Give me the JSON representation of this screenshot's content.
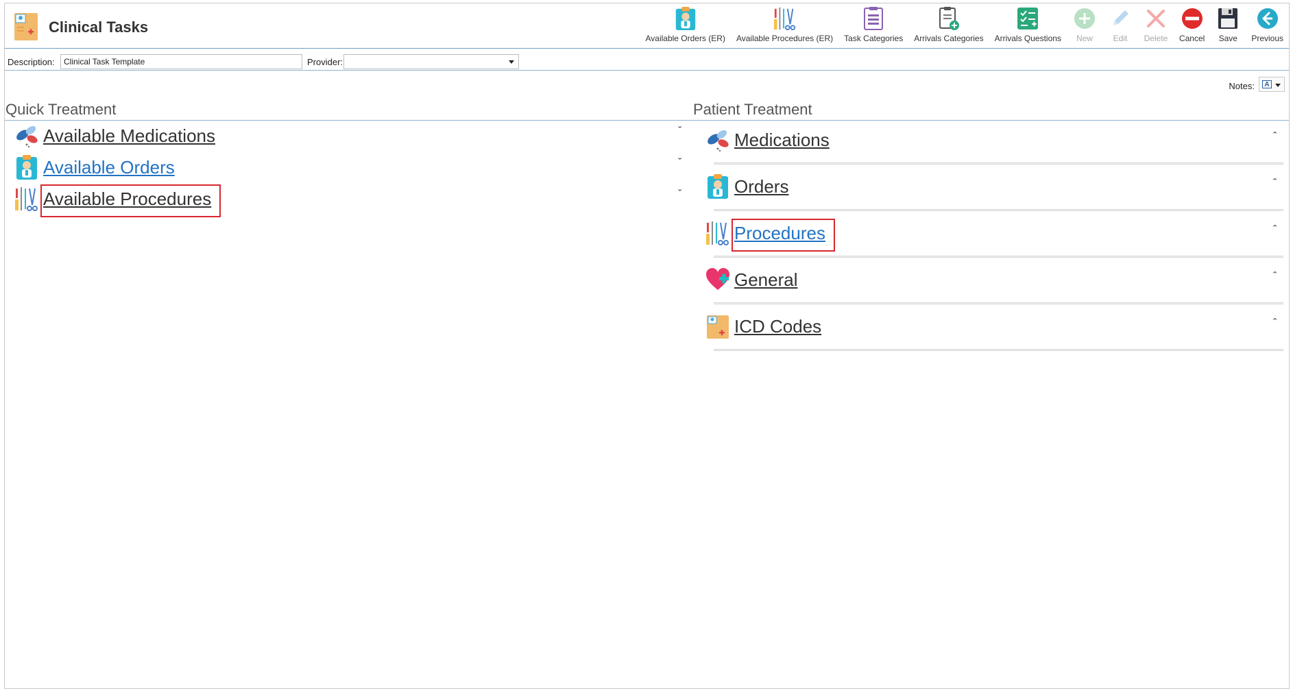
{
  "app": {
    "title": "Clinical Tasks"
  },
  "toolbar": [
    {
      "name": "available-orders-er-button",
      "label": "Available Orders (ER)",
      "icon": "orders-icon",
      "enabled": true
    },
    {
      "name": "available-procedures-er-button",
      "label": "Available Procedures (ER)",
      "icon": "procedures-icon",
      "enabled": true
    },
    {
      "name": "task-categories-button",
      "label": "Task Categories",
      "icon": "clipboard-list-icon",
      "enabled": true
    },
    {
      "name": "arrivals-categories-button",
      "label": "Arrivals Categories",
      "icon": "clipboard-add-icon",
      "enabled": true
    },
    {
      "name": "arrivals-questions-button",
      "label": "Arrivals Questions",
      "icon": "checklist-icon",
      "enabled": true
    },
    {
      "name": "new-button",
      "label": "New",
      "icon": "plus-circle-icon",
      "enabled": false
    },
    {
      "name": "edit-button",
      "label": "Edit",
      "icon": "pencil-icon",
      "enabled": false
    },
    {
      "name": "delete-button",
      "label": "Delete",
      "icon": "x-icon",
      "enabled": false
    },
    {
      "name": "cancel-button",
      "label": "Cancel",
      "icon": "no-entry-icon",
      "enabled": true
    },
    {
      "name": "save-button",
      "label": "Save",
      "icon": "floppy-disk-icon",
      "enabled": true
    },
    {
      "name": "previous-button",
      "label": "Previous",
      "icon": "arrow-left-circle-icon",
      "enabled": true
    }
  ],
  "form": {
    "description_label": "Description:",
    "description_value": "Clinical Task Template",
    "provider_label": "Provider:",
    "provider_value": ""
  },
  "notes": {
    "label": "Notes:"
  },
  "quick_treatment": {
    "title": "Quick Treatment",
    "items": [
      {
        "label": "Available Medications",
        "icon": "pills-icon",
        "color": "dark",
        "highlighted": false,
        "expanded": false
      },
      {
        "label": "Available Orders",
        "icon": "orders-icon",
        "color": "blue",
        "highlighted": false,
        "expanded": false
      },
      {
        "label": "Available Procedures",
        "icon": "procedures-icon",
        "color": "dark",
        "highlighted": true,
        "expanded": false
      }
    ]
  },
  "patient_treatment": {
    "title": "Patient Treatment",
    "items": [
      {
        "label": "Medications",
        "icon": "pills-icon",
        "color": "dark",
        "highlighted": false,
        "expanded": true
      },
      {
        "label": "Orders",
        "icon": "orders-icon",
        "color": "dark",
        "highlighted": false,
        "expanded": true
      },
      {
        "label": "Procedures",
        "icon": "procedures-icon",
        "color": "blue",
        "highlighted": true,
        "expanded": true
      },
      {
        "label": "General",
        "icon": "heart-plus-icon",
        "color": "dark",
        "highlighted": false,
        "expanded": true
      },
      {
        "label": "ICD Codes",
        "icon": "medical-folder-icon",
        "color": "dark",
        "highlighted": false,
        "expanded": true
      }
    ]
  },
  "colors": {
    "accent_blue": "#2273c4",
    "highlight_red": "#d9272e",
    "header_rule": "#6f9fc8"
  }
}
